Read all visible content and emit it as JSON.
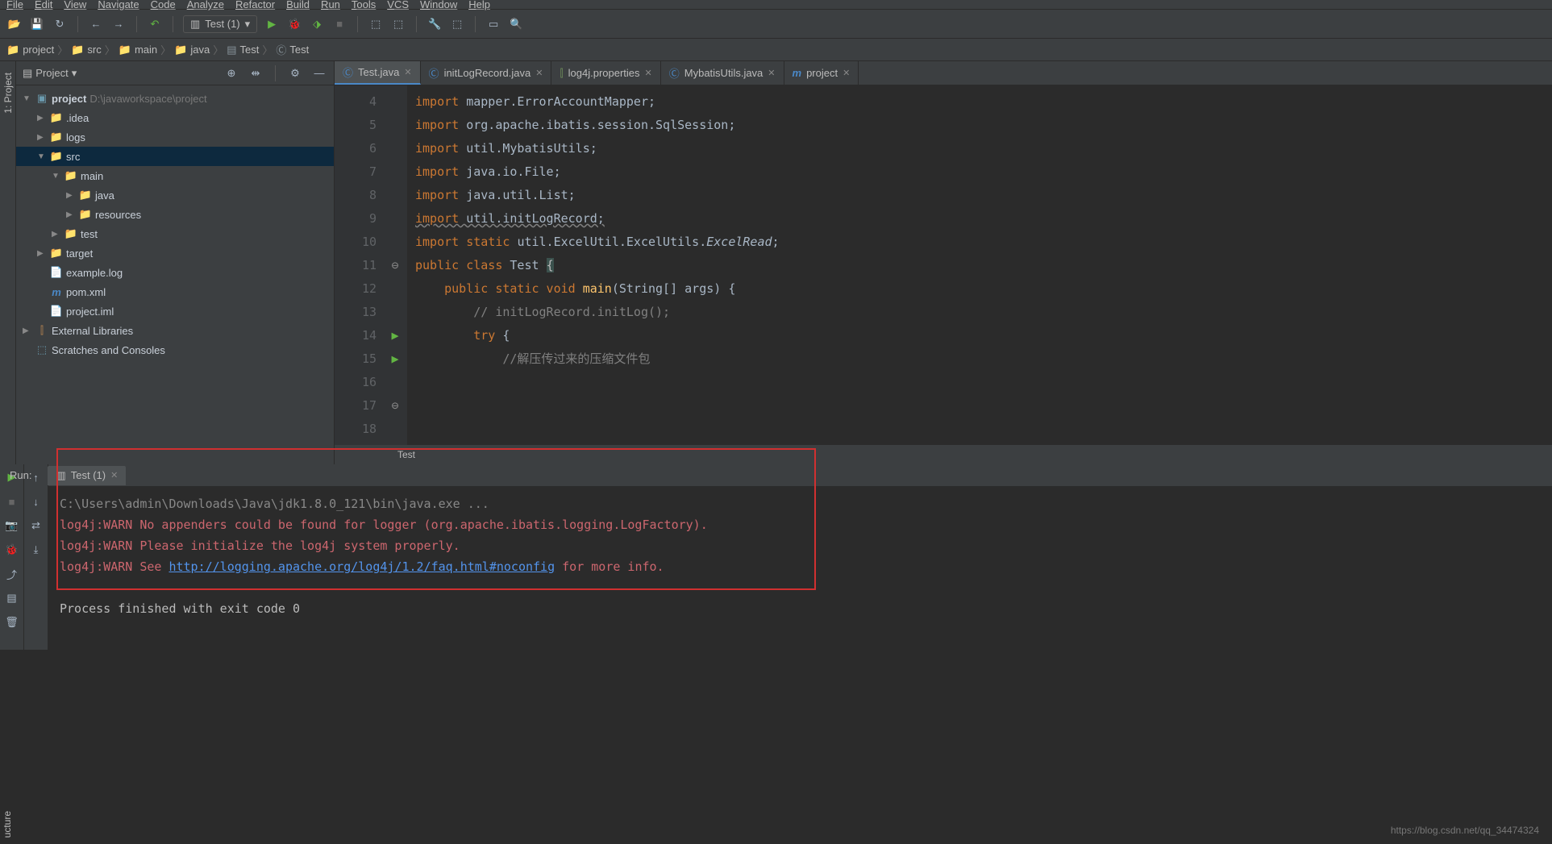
{
  "menu": [
    "File",
    "Edit",
    "View",
    "Navigate",
    "Code",
    "Analyze",
    "Refactor",
    "Build",
    "Run",
    "Tools",
    "VCS",
    "Window",
    "Help"
  ],
  "toolbar": {
    "config_label": "Test (1)"
  },
  "breadcrumb": [
    "project",
    "src",
    "main",
    "java",
    "Test",
    "Test"
  ],
  "side_tabs": {
    "project": "1: Project",
    "structure": "ucture"
  },
  "panel": {
    "title": "Project",
    "tree": {
      "root": "project",
      "root_path": "D:\\javaworkspace\\project",
      "items": [
        {
          "indent": 1,
          "arrow": "▶",
          "icon": "folder",
          "label": ".idea"
        },
        {
          "indent": 1,
          "arrow": "▶",
          "icon": "folder",
          "label": "logs"
        },
        {
          "indent": 1,
          "arrow": "▼",
          "icon": "folder",
          "label": "src",
          "selected": true
        },
        {
          "indent": 2,
          "arrow": "▼",
          "icon": "folder",
          "label": "main"
        },
        {
          "indent": 3,
          "arrow": "▶",
          "icon": "folder-blue",
          "label": "java"
        },
        {
          "indent": 3,
          "arrow": "▶",
          "icon": "folder-res",
          "label": "resources"
        },
        {
          "indent": 2,
          "arrow": "▶",
          "icon": "folder",
          "label": "test"
        },
        {
          "indent": 1,
          "arrow": "▶",
          "icon": "folder-target",
          "label": "target"
        },
        {
          "indent": 1,
          "arrow": "",
          "icon": "file",
          "label": "example.log"
        },
        {
          "indent": 1,
          "arrow": "",
          "icon": "maven",
          "label": "pom.xml"
        },
        {
          "indent": 1,
          "arrow": "",
          "icon": "file",
          "label": "project.iml"
        }
      ],
      "ext_lib": "External Libraries",
      "scratches": "Scratches and Consoles"
    }
  },
  "tabs": [
    {
      "icon": "class",
      "label": "Test.java",
      "active": true
    },
    {
      "icon": "class",
      "label": "initLogRecord.java"
    },
    {
      "icon": "props",
      "label": "log4j.properties"
    },
    {
      "icon": "class",
      "label": "MybatisUtils.java"
    },
    {
      "icon": "maven",
      "label": "project"
    }
  ],
  "editor": {
    "lines": [
      {
        "n": 4,
        "html": "<span class='kw'>import</span> <span class='id'>mapper.ErrorAccountMapper;</span>"
      },
      {
        "n": 5,
        "html": "<span class='kw'>import</span> <span class='id'>org.apache.ibatis.session.SqlSession;</span>"
      },
      {
        "n": 6,
        "html": "<span class='kw'>import</span> <span class='id'>util.MybatisUtils;</span>"
      },
      {
        "n": 7,
        "html": ""
      },
      {
        "n": 8,
        "html": "<span class='kw'>import</span> <span class='id'>java.io.File;</span>"
      },
      {
        "n": 9,
        "html": "<span class='kw'>import</span> <span class='id'>java.util.List;</span>"
      },
      {
        "n": 10,
        "html": "<span class='kw underline'>import</span><span class='id underline'> util.initLogRecord;</span>"
      },
      {
        "n": 11,
        "html": "<span class='kw'>import static</span> <span class='id'>util.ExcelUtil.ExcelUtils.</span><span class='id imp'>ExcelRead</span><span class='id'>;</span>",
        "fold": "⊖"
      },
      {
        "n": 12,
        "html": ""
      },
      {
        "n": 13,
        "html": ""
      },
      {
        "n": 14,
        "html": "<span class='kw'>public class</span> <span class='id'>Test </span><span class='brace-hl'>{</span>",
        "run": true
      },
      {
        "n": 15,
        "html": "    <span class='kw'>public static void</span> <span class='fn'>main</span><span class='id'>(String[] args) {</span>",
        "run": true,
        "fold": "⊖"
      },
      {
        "n": 16,
        "html": "        <span class='cmt'>// initLogRecord.initLog();</span>"
      },
      {
        "n": 17,
        "html": "        <span class='kw'>try</span> <span class='id'>{</span>",
        "fold": "⊖"
      },
      {
        "n": 18,
        "html": "            <span class='cmt'>//解压传过来的压缩文件包</span>"
      }
    ],
    "footer_crumb": "Test"
  },
  "run": {
    "label": "Run:",
    "tab": "Test (1)",
    "lines": [
      {
        "cls": "cmd",
        "text": "C:\\Users\\admin\\Downloads\\Java\\jdk1.8.0_121\\bin\\java.exe ..."
      },
      {
        "cls": "err",
        "text": "log4j:WARN No appenders could be found for logger (org.apache.ibatis.logging.LogFactory)."
      },
      {
        "cls": "err",
        "text": "log4j:WARN Please initialize the log4j system properly."
      },
      {
        "cls": "err",
        "pre": "log4j:WARN See ",
        "link": "http://logging.apache.org/log4j/1.2/faq.html#noconfig",
        "post": " for more info."
      },
      {
        "cls": "ok",
        "text": ""
      },
      {
        "cls": "ok",
        "text": "Process finished with exit code 0"
      }
    ]
  },
  "watermark": "https://blog.csdn.net/qq_34474324"
}
